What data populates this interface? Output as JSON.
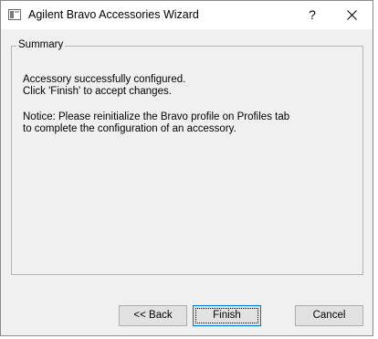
{
  "window": {
    "title": "Agilent Bravo Accessories Wizard",
    "icon": "app-window-icon",
    "help_glyph": "?",
    "close_icon": "close-icon"
  },
  "summary": {
    "legend": "Summary",
    "lines": [
      "Accessory successfully configured.",
      "Click 'Finish' to accept changes.",
      "Notice: Please reinitialize the Bravo profile on Profiles tab",
      "to complete the configuration of an accessory."
    ]
  },
  "buttons": {
    "back": "<< Back",
    "finish": "Finish",
    "cancel": "Cancel"
  },
  "colors": {
    "titlebar_bg": "#ffffff",
    "dialog_bg": "#f0f0f0",
    "button_bg": "#e1e1e1",
    "default_button_border": "#0078d7"
  }
}
